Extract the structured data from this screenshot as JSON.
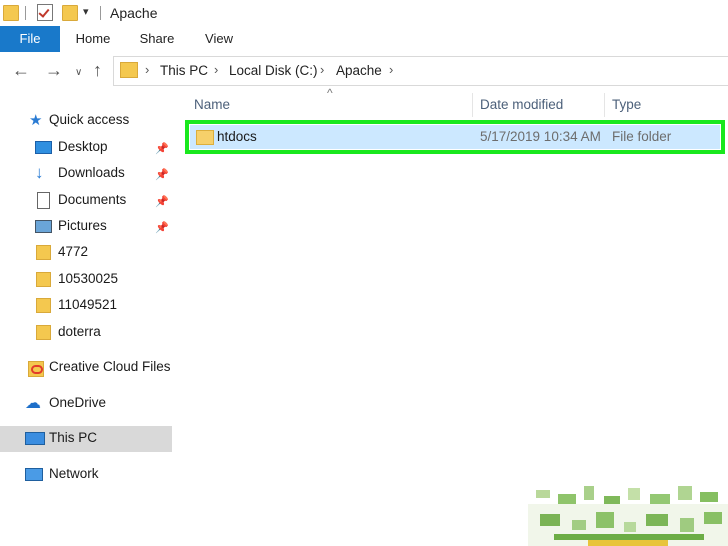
{
  "window": {
    "title": "Apache"
  },
  "ribbon": {
    "tabs": [
      "File",
      "Home",
      "Share",
      "View"
    ]
  },
  "address": {
    "crumbs": [
      "This PC",
      "Local Disk (C:)",
      "Apache"
    ]
  },
  "nav_pane": {
    "quick_access": "Quick access",
    "items": [
      {
        "label": "Desktop",
        "icon": "desktop-icon",
        "pinned": true
      },
      {
        "label": "Downloads",
        "icon": "download-icon",
        "pinned": true
      },
      {
        "label": "Documents",
        "icon": "document-icon",
        "pinned": true
      },
      {
        "label": "Pictures",
        "icon": "picture-icon",
        "pinned": true
      },
      {
        "label": "4772",
        "icon": "folder-icon",
        "pinned": false
      },
      {
        "label": "10530025",
        "icon": "folder-icon",
        "pinned": false
      },
      {
        "label": "11049521",
        "icon": "folder-icon",
        "pinned": false
      },
      {
        "label": "doterra",
        "icon": "folder-icon",
        "pinned": false
      }
    ],
    "creative_cloud": "Creative Cloud Files",
    "onedrive": "OneDrive",
    "this_pc": "This PC",
    "network": "Network"
  },
  "columns": {
    "name": "Name",
    "date": "Date modified",
    "type": "Type"
  },
  "files": [
    {
      "name": "htdocs",
      "date": "5/17/2019 10:34 AM",
      "type": "File folder"
    }
  ],
  "colors": {
    "accent": "#1979ca",
    "highlight": "#19e81d",
    "selection": "#cce8ff",
    "folder": "#f4c84f"
  }
}
